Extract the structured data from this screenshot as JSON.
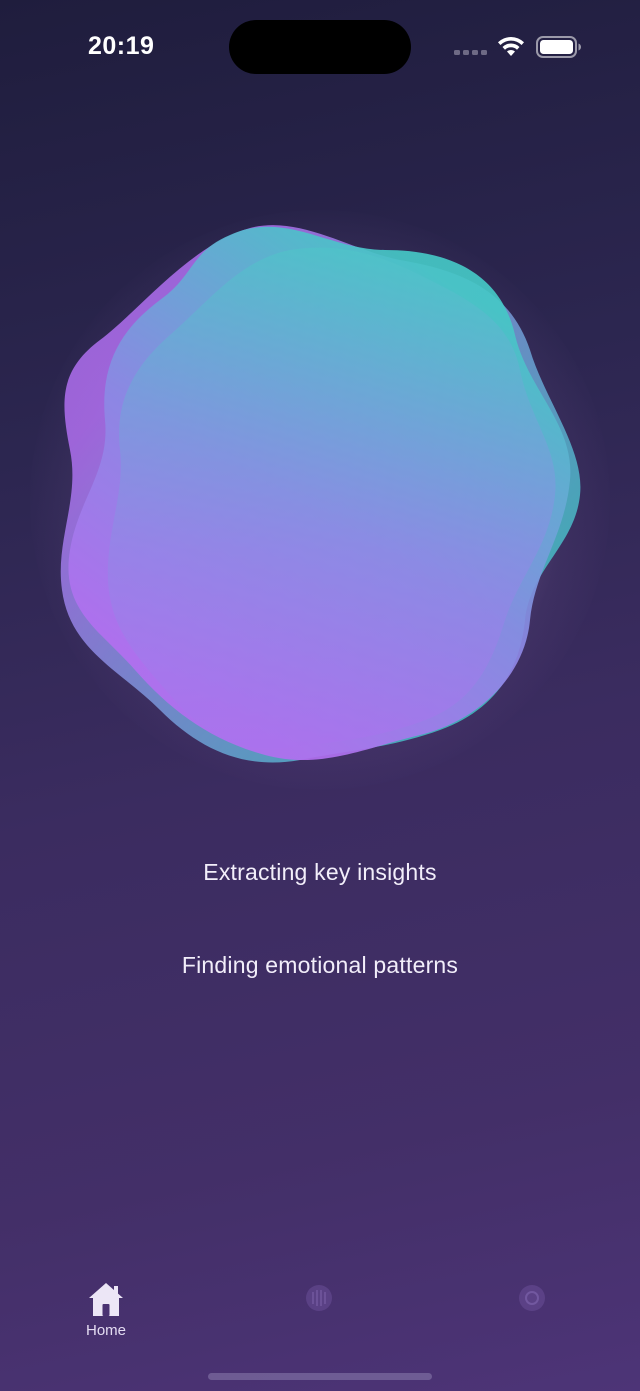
{
  "status_bar": {
    "time": "20:19",
    "icons": [
      "cellular-signal-icon",
      "wifi-icon",
      "battery-icon"
    ]
  },
  "visual": {
    "name": "morphing-orb",
    "colors": {
      "purple": "#b06ff0",
      "teal": "#3fc3c3",
      "glow": "#e6c8f0"
    }
  },
  "progress": {
    "steps": [
      "Extracting key insights",
      "Finding emotional patterns"
    ]
  },
  "tabbar": {
    "items": [
      {
        "label": "Home",
        "icon": "home-icon",
        "selected": true
      },
      {
        "label": "",
        "icon": "tab-2-icon",
        "selected": false
      },
      {
        "label": "",
        "icon": "tab-3-icon",
        "selected": false
      }
    ]
  },
  "colors": {
    "background_top": "#1f1d3d",
    "background_bottom": "#4d3477",
    "text": "#f2eefa"
  }
}
